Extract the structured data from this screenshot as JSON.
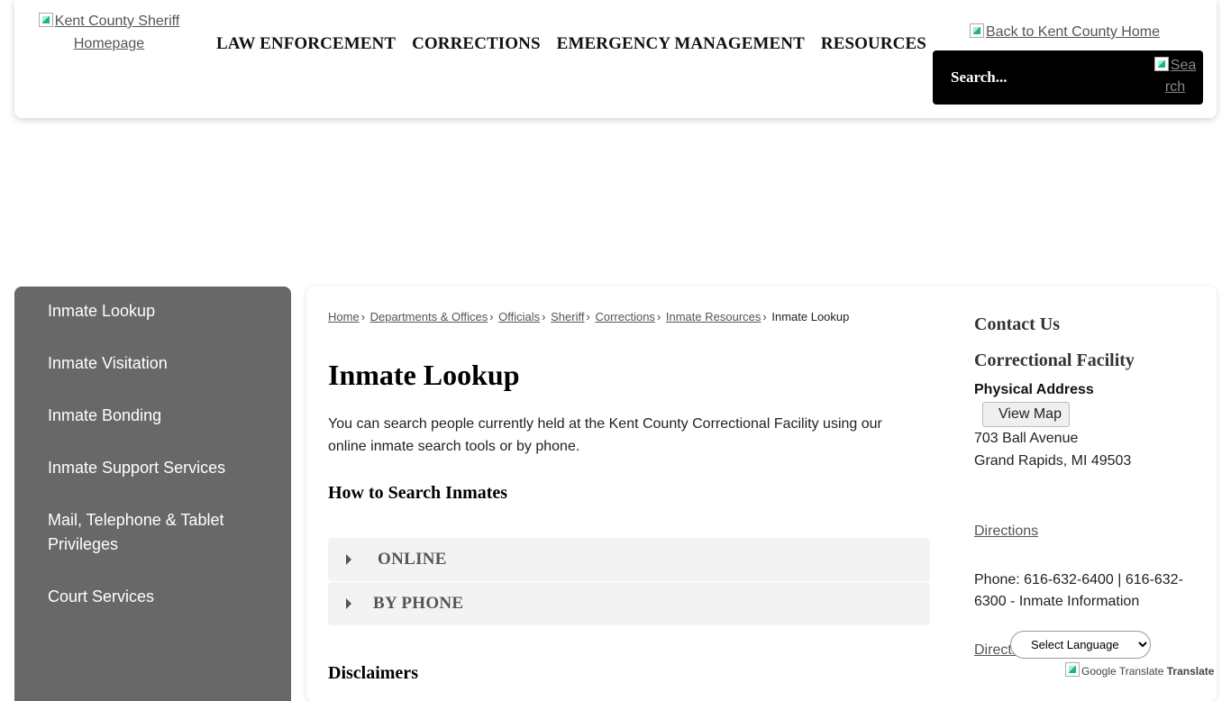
{
  "header": {
    "logo_alt": "Kent County Sheriff Homepage",
    "nav": [
      "LAW ENFORCEMENT",
      "CORRECTIONS",
      "EMERGENCY MANAGEMENT",
      "RESOURCES"
    ],
    "back_link": "Back to Kent County Home",
    "search_placeholder": "Search...",
    "search_button": "Search"
  },
  "sidebar": {
    "items": [
      "Inmate Lookup",
      "Inmate Visitation",
      "Inmate Bonding",
      "Inmate Support Services",
      "Mail, Telephone & Tablet Privileges",
      "Court Services"
    ]
  },
  "breadcrumb": {
    "links": [
      "Home",
      "Departments & Offices",
      "Officials",
      "Sheriff",
      "Corrections",
      "Inmate Resources"
    ],
    "current": "Inmate Lookup",
    "separator": "›"
  },
  "main": {
    "title": "Inmate Lookup",
    "intro": "You can search people currently held at the Kent County Correctional Facility using our online inmate search tools or by phone.",
    "how_to_heading": "How to Search Inmates",
    "accordions": [
      "ONLINE",
      "BY PHONE"
    ],
    "disclaimers_heading": "Disclaimers"
  },
  "contact": {
    "title": "Contact Us",
    "facility": "Correctional Facility",
    "address_label": "Physical Address",
    "view_map": "View Map",
    "address_line1": "703 Ball Avenue",
    "address_line2": "Grand Rapids, MI 49503",
    "directions": "Directions",
    "phone": "Phone: 616-632-6400 | 616-632-6300 - Inmate Information",
    "directions_2": "Directions"
  },
  "translate": {
    "select_label": "Select Language",
    "credit_img_alt": "Google Translate",
    "credit_text": "Translate"
  }
}
